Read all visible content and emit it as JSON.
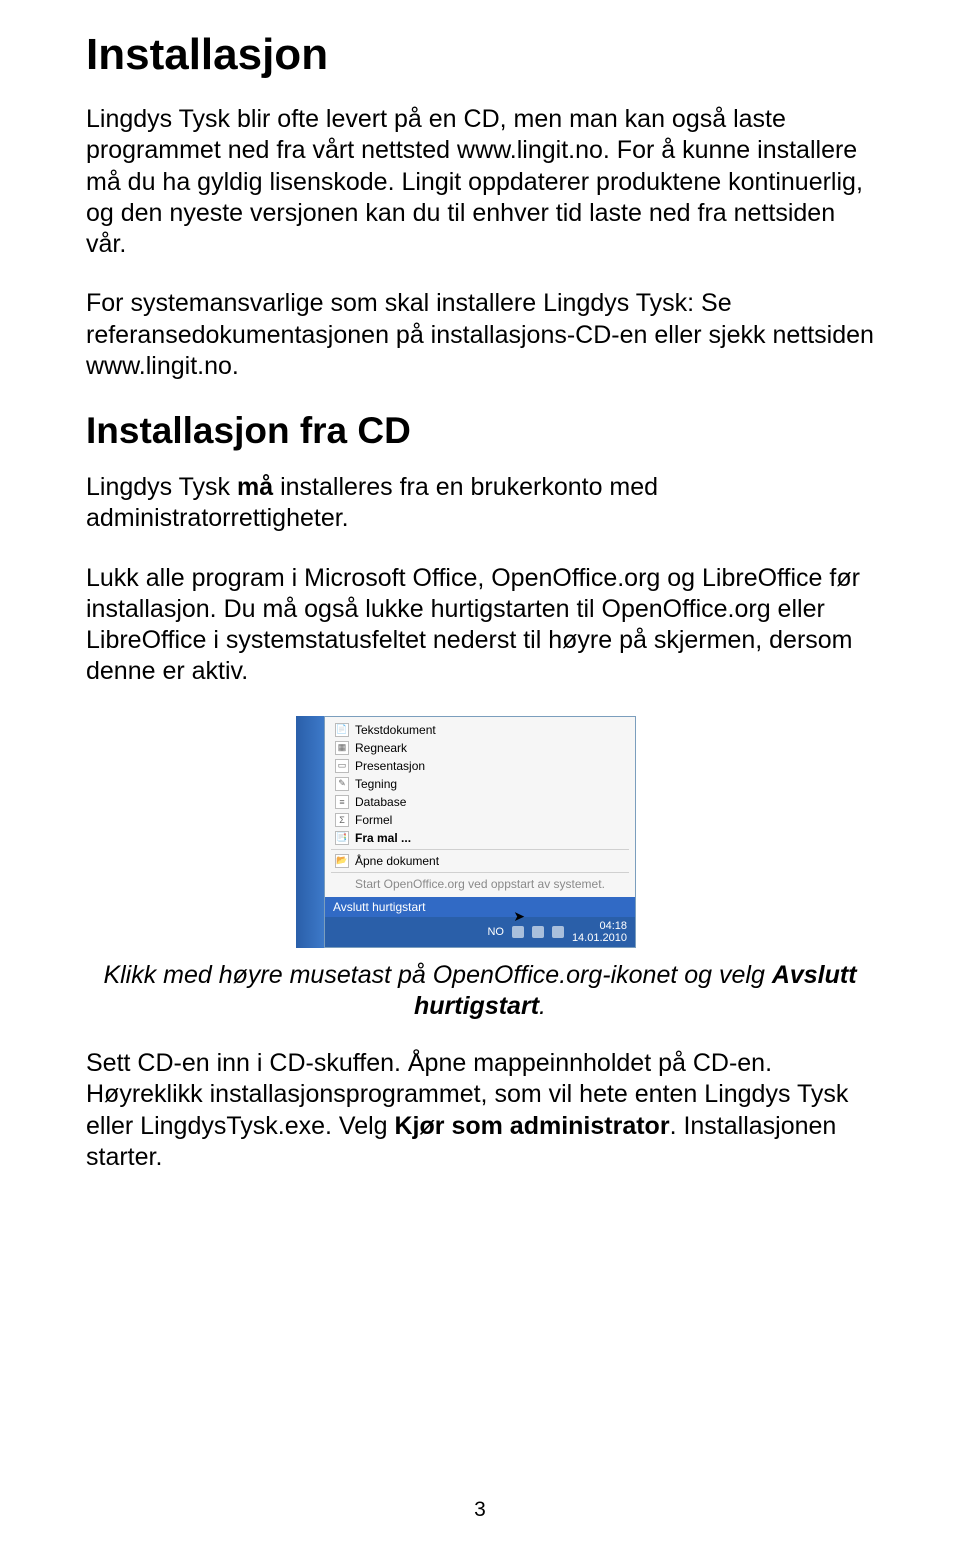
{
  "title": "Installasjon",
  "para1": "Lingdys Tysk blir ofte levert på en CD, men man kan også laste programmet ned fra vårt nettsted www.lingit.no. For å kunne installere må du ha gyldig lisenskode. Lingit oppdaterer produktene kontinuerlig, og den nyeste versjonen kan du til enhver tid laste ned fra nettsiden vår.",
  "para2": "For systemansvarlige som skal installere Lingdys Tysk: Se referansedokumentasjonen på installasjons-CD-en eller sjekk nettsiden www.lingit.no.",
  "heading2": "Installasjon fra CD",
  "para3_a": "Lingdys Tysk ",
  "para3_b": "må",
  "para3_c": " installeres fra en brukerkonto med administratorrettigheter.",
  "para4": "Lukk alle program i Microsoft Office, OpenOffice.org og LibreOffice før installasjon. Du må også lukke hurtigstarten til OpenOffice.org eller LibreOffice i systemstatusfeltet nederst til høyre på skjermen, dersom denne er aktiv.",
  "caption_a": "Klikk med høyre musetast på OpenOffice.org-ikonet og velg ",
  "caption_b": "Avslutt hurtigstart",
  "caption_c": ".",
  "para5_a": "Sett CD-en inn i CD-skuffen. Åpne mappeinnholdet på CD-en. Høyreklikk installasjonsprogrammet, som vil hete enten Lingdys Tysk eller LingdysTysk.exe. Velg ",
  "para5_b": "Kjør som administrator",
  "para5_c": ". Installasjonen starter.",
  "page_number": "3",
  "menu": {
    "items": [
      "Tekstdokument",
      "Regneark",
      "Presentasjon",
      "Tegning",
      "Database",
      "Formel"
    ],
    "from_template": "Fra mal ...",
    "open_doc": "Åpne dokument",
    "startup": "Start OpenOffice.org ved oppstart av systemet.",
    "quit": "Avslutt hurtigstart",
    "lang": "NO",
    "time": "04:18",
    "date": "14.01.2010"
  }
}
